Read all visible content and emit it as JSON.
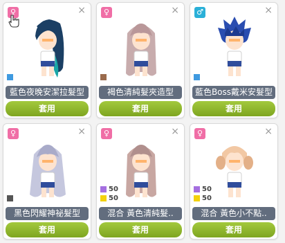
{
  "cards": [
    {
      "gender_glyph": "♀",
      "gender_color": "#f06ea6",
      "swatches": [
        {
          "color": "#3f9ae0",
          "pct": ""
        }
      ],
      "name": "藍色夜晚安潔拉髮型",
      "apply_label": "套用",
      "hair_color": "#1b3f64",
      "hair_tint": "#1aa6a6",
      "hair_style": "long-pony"
    },
    {
      "gender_glyph": "♀",
      "gender_color": "#f06ea6",
      "swatches": [
        {
          "color": "#9a6b4d",
          "pct": ""
        }
      ],
      "name": "褐色清純髮夾造型",
      "apply_label": "套用",
      "hair_color": "#c8acad",
      "hair_tint": "#b99799",
      "hair_style": "long-straight"
    },
    {
      "gender_glyph": "♂",
      "gender_color": "#2ab0d8",
      "swatches": [
        {
          "color": "#3f9ae0",
          "pct": ""
        }
      ],
      "name": "藍色Boss戴米安髮型",
      "apply_label": "套用",
      "hair_color": "#2a4db0",
      "hair_tint": "#1d3a8f",
      "hair_style": "spiky"
    },
    {
      "gender_glyph": "♀",
      "gender_color": "#f06ea6",
      "swatches": [
        {
          "color": "#555555",
          "pct": ""
        }
      ],
      "name": "黑色閃耀神祕髮型",
      "apply_label": "套用",
      "hair_color": "#c5c7de",
      "hair_tint": "#a9abc9",
      "hair_style": "long-wavy"
    },
    {
      "gender_glyph": "♀",
      "gender_color": "#f06ea6",
      "swatches": [
        {
          "color": "#a56fe0",
          "pct": "50"
        },
        {
          "color": "#f3d10e",
          "pct": "50"
        }
      ],
      "name": "混合 黃色清純髮..",
      "apply_label": "套用",
      "hair_color": "#c8a7a2",
      "hair_tint": "#b08f8d",
      "hair_style": "long-straight"
    },
    {
      "gender_glyph": "♀",
      "gender_color": "#f06ea6",
      "swatches": [
        {
          "color": "#a56fe0",
          "pct": "50"
        },
        {
          "color": "#f3d10e",
          "pct": "50"
        }
      ],
      "name": "混合 黃色小不點..",
      "apply_label": "套用",
      "hair_color": "#f2c8a4",
      "hair_tint": "#e3b088",
      "hair_style": "short-tails"
    }
  ],
  "close_glyph": "×"
}
